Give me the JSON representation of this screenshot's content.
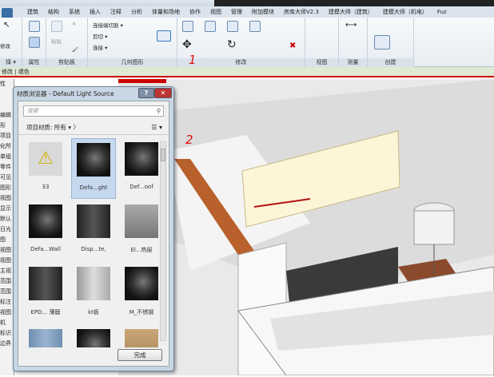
{
  "ribbon_tabs": [
    "建筑",
    "结构",
    "系统",
    "插入",
    "注释",
    "分析",
    "体量和场地",
    "协作",
    "视图",
    "管理",
    "附加模块",
    "房库大师V2.3",
    "建模大师（建筑）",
    "建模大师（机电）",
    "Fuz"
  ],
  "ribbon_panels": {
    "select": "择 ▾",
    "properties": "属性",
    "clipboard": "剪贴板",
    "geometry": "几何图形",
    "modify": "修改",
    "view": "视图",
    "measure": "测量",
    "create": "创建"
  },
  "ribbon_buttons": {
    "modify": "修改",
    "paste": "粘贴",
    "cope": "连接端切割 ▾",
    "cut": "剪切 ▾",
    "join": "连接 ▾"
  },
  "context_bar": "修改 | 墙色",
  "properties_rows": [
    "性",
    "",
    "",
    "编辑",
    "形",
    "项目",
    "化所",
    "单组",
    "零件",
    "可见",
    "图形",
    "视图",
    "显示",
    "默认",
    "日光",
    "图",
    "视图",
    "视图",
    "主视",
    "范围",
    "范围",
    "标注",
    "视图",
    "机",
    "标识",
    "边界"
  ],
  "dialog": {
    "title": "材质浏览器 - Default Light Source",
    "help": "?",
    "close": "✕",
    "search_placeholder": "搜索",
    "filter": "项目材质: 所有",
    "done": "完成",
    "materials": [
      {
        "label": "33",
        "thumb": "warning"
      },
      {
        "label": "Defa...ght",
        "thumb": "sphere",
        "selected": true
      },
      {
        "label": "Def...oof",
        "thumb": "sphere"
      },
      {
        "label": "Defa...Wall",
        "thumb": "sphere"
      },
      {
        "label": "Disp...te,",
        "thumb": "cylinder"
      },
      {
        "label": "El...热层",
        "thumb": "wall"
      },
      {
        "label": "EPD... 薄膜",
        "thumb": "cylinder"
      },
      {
        "label": "kt板",
        "thumb": "wall-light"
      },
      {
        "label": "M_不锈钢",
        "thumb": "sphere"
      },
      {
        "label": "",
        "thumb": "blue-panel"
      },
      {
        "label": "",
        "thumb": "sphere"
      },
      {
        "label": "",
        "thumb": "box"
      }
    ]
  },
  "annotations": {
    "one": "1",
    "two": "2"
  },
  "colors": {
    "annotation": "#cc1111",
    "selection": "#c5d8ee",
    "context_bar": "#dfe9d3"
  }
}
